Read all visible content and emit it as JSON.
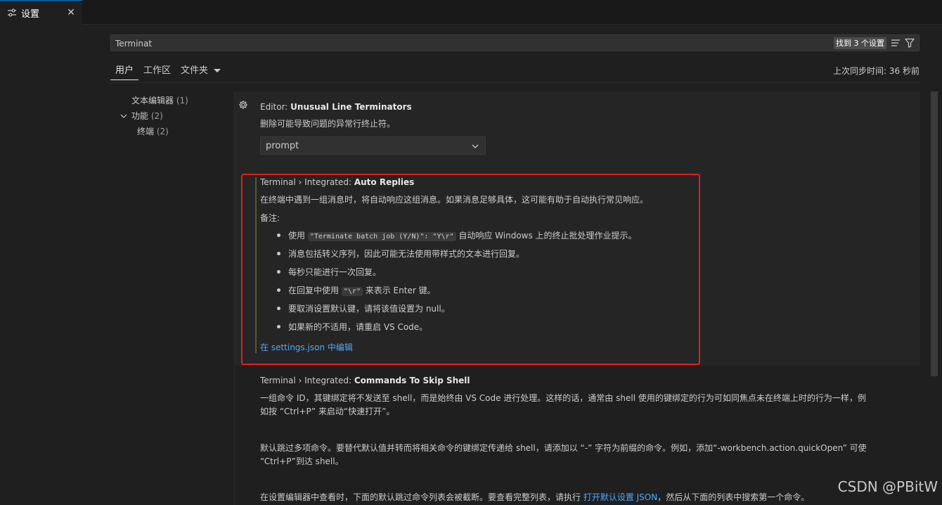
{
  "tab": {
    "title": "设置",
    "close": "✕"
  },
  "search": {
    "value": "Terminat",
    "result_count": "找到 3 个设置"
  },
  "scopes": {
    "user": "用户",
    "workspace": "工作区",
    "folder": "文件夹"
  },
  "sync_status": "上次同步时间: 36 秒前",
  "toc": {
    "items": [
      {
        "label": "文本编辑器",
        "count": "(1)"
      },
      {
        "label": "功能",
        "count": "(2)"
      },
      {
        "label": "终端",
        "count": "(2)"
      }
    ]
  },
  "settings": {
    "s1": {
      "category": "Editor: ",
      "name": "Unusual Line Terminators",
      "desc": "删除可能导致问题的异常行终止符。",
      "select_value": "prompt"
    },
    "s2": {
      "category": "Terminal › Integrated: ",
      "name": "Auto Replies",
      "desc": "在终端中遇到一组消息时，将自动响应这组消息。如果消息足够具体，这可能有助于自动执行常见响应。",
      "note_label": "备注:",
      "b1_pre": "使用 ",
      "b1_code": "\"Terminate batch job (Y/N)\": \"Y\\r\"",
      "b1_post": " 自动响应 Windows 上的终止批处理作业提示。",
      "b2": "消息包括转义序列，因此可能无法使用带样式的文本进行回复。",
      "b3": "每秒只能进行一次回复。",
      "b4_pre": "在回复中使用 ",
      "b4_code": "\"\\r\"",
      "b4_post": " 来表示 Enter 键。",
      "b5": "要取消设置默认键，请将该值设置为 null。",
      "b6": "如果新的不适用，请重启 VS Code。",
      "edit_link": "在 settings.json 中编辑"
    },
    "s3": {
      "category": "Terminal › Integrated: ",
      "name": "Commands To Skip Shell",
      "desc1_line1": "一组命令 ID，其键绑定将不发送至 shell，而是始终由 VS Code 进行处理。这样的话，通常由 shell 使用的键绑定的行为可如同焦点未在终端上时的行为一样，例",
      "desc1_line2": "如按 “Ctrl+P” 来启动“快速打开”。",
      "desc2_line1": "默认跳过多项命令。要替代默认值并转而将相关命令的键绑定传递给 shell，请添加以 “-” 字符为前缀的命令。例如，添加“-workbench.action.quickOpen” 可使",
      "desc2_line2": "“Ctrl+P”到达 shell。",
      "desc3_pre": "在设置编辑器中查看时，下面的默认跳过命令列表会被截断。要查看完整列表，请执行 ",
      "desc3_link": "打开默认设置 JSON",
      "desc3_post": "，然后从下面的列表中搜索第一个命令。"
    }
  },
  "watermark": "CSDN @PBitW",
  "colors": {
    "accent": "#0078d4",
    "annotation": "#e0201e",
    "link": "#4daafc"
  }
}
